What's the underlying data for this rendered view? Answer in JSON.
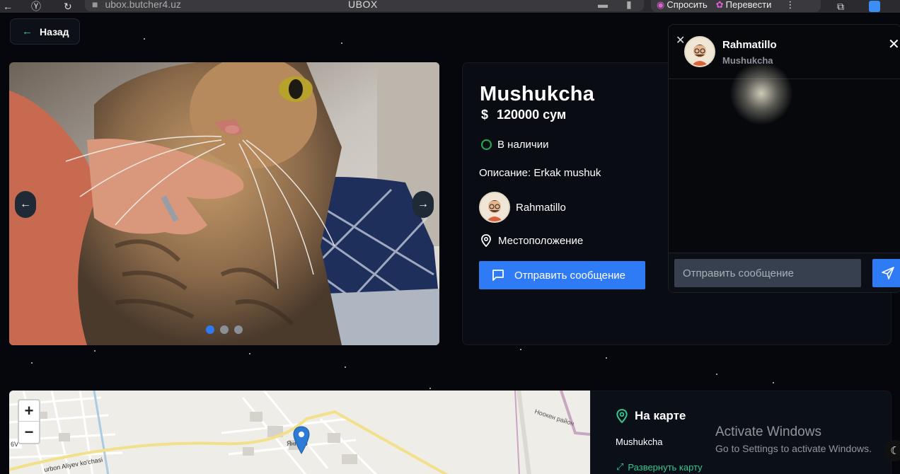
{
  "browser": {
    "url": "ubox.butcher4.uz",
    "title": "UBOX",
    "ask_label": "Спросить",
    "translate_label": "Перевести"
  },
  "back_label": "Назад",
  "product": {
    "name": "Mushukcha",
    "price": "120000 сум",
    "stock": "В наличии",
    "description": "Описание: Erkak mushuk",
    "seller": "Rahmatillo",
    "location": "Местоположение",
    "send_message": "Отправить сообщение"
  },
  "carousel": {
    "slide_count": 3,
    "active_index": 0
  },
  "chat": {
    "name": "Rahmatillo",
    "subtitle": "Mushukcha",
    "input_placeholder": "Отправить сообщение"
  },
  "map": {
    "title": "На карте",
    "item_name": "Mushukcha",
    "expand_label": "Развернуть карту",
    "street_label": "urbon Aliyev ko'chasi",
    "place_label": "Янгиер",
    "road_label": "Ноокен район",
    "zoom_in": "+",
    "zoom_out": "−"
  },
  "watermark": {
    "line1": "Activate Windows",
    "line2": "Go to Settings to activate Windows."
  },
  "colors": {
    "accent": "#2f7bf6",
    "stock": "#19b25a",
    "map_accent": "#33c98e"
  }
}
